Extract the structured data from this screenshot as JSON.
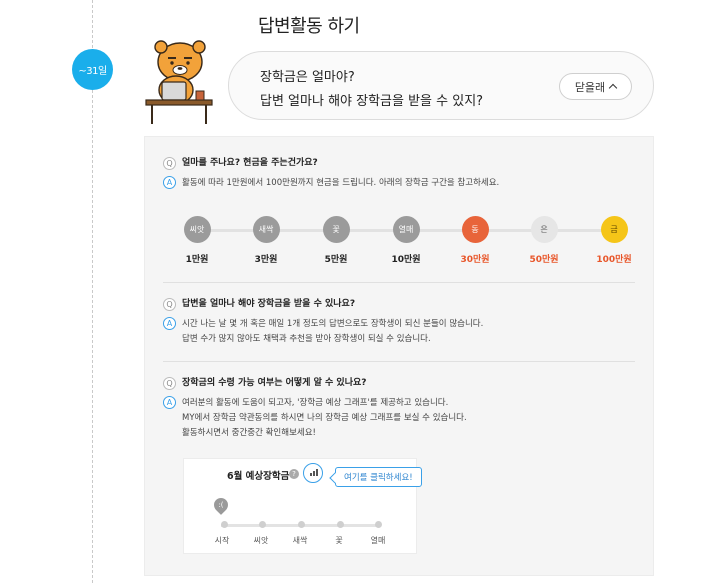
{
  "page": {
    "title": "답변활동 하기",
    "date_badge": "~31일"
  },
  "bubble": {
    "line1": "장학금은 얼마야?",
    "line2": "답변 얼마나 해야 장학금을 받을 수 있지?",
    "close_label": "닫을래"
  },
  "faq": [
    {
      "q": "얼마를 주나요? 현금을 주는건가요?",
      "a": [
        "활동에 따라 1만원에서 100만원까지 현금을 드립니다. 아래의 장학금 구간을 참고하세요."
      ]
    },
    {
      "q": "답변을 얼마나 해야 장학금을 받을 수 있나요?",
      "a": [
        "시간 나는 날 몇 개 혹은 매일 1개 정도의 답변으로도 장학생이 되신 분들이 많습니다.",
        "답변 수가 많지 않아도 채택과 추천을 받아 장학생이 되실 수 있습니다."
      ]
    },
    {
      "q": "장학금의 수령 가능 여부는 어떻게 알 수 있나요?",
      "a": [
        "여러분의 활동에 도움이 되고자, '장학금 예상 그래프'를 제공하고 있습니다.",
        "MY에서 장학금 약관동의를 하시면 나의 장학금 예상 그래프를 보실 수 있습니다.",
        "활동하시면서 중간중간 확인해보세요!"
      ]
    }
  ],
  "qa_markers": {
    "q": "Q",
    "a": "A"
  },
  "levels": [
    {
      "name": "씨앗",
      "amount": "1만원",
      "color": "#9b9b9b"
    },
    {
      "name": "새싹",
      "amount": "3만원",
      "color": "#9b9b9b"
    },
    {
      "name": "꽃",
      "amount": "5만원",
      "color": "#9b9b9b"
    },
    {
      "name": "열매",
      "amount": "10만원",
      "color": "#9b9b9b"
    },
    {
      "name": "동",
      "amount": "30만원",
      "color": "#e8643a"
    },
    {
      "name": "은",
      "amount": "50만원",
      "color": "#e6e6e6"
    },
    {
      "name": "금",
      "amount": "100만원",
      "color": "#f5c518"
    }
  ],
  "graph": {
    "title": "6월 예상장학금",
    "help": "?",
    "tooltip": "여기를 클릭하세요!",
    "stages": [
      "시작",
      "씨앗",
      "새싹",
      "꽃",
      "열매"
    ]
  },
  "colors": {
    "accent": "#1aaeeb",
    "highlight": "#e8562a"
  }
}
